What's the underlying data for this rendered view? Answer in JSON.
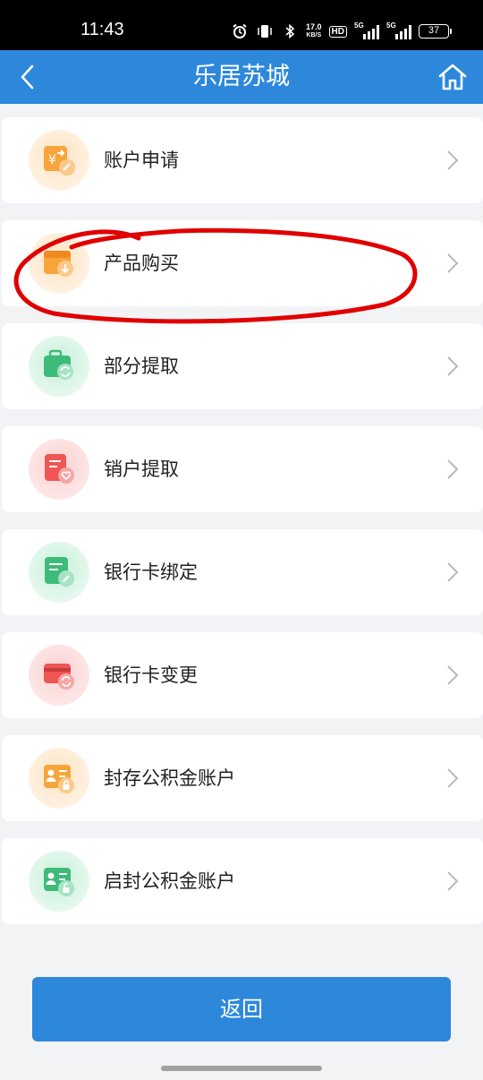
{
  "status_bar": {
    "time": "11:43",
    "net_speed_value": "17.0",
    "net_speed_unit": "KB/S",
    "hd_label": "HD",
    "signal1_label": "5G",
    "signal2_label": "5G",
    "battery": "37"
  },
  "header": {
    "title": "乐居苏城",
    "back_icon": "chevron-left-icon",
    "home_icon": "home-icon",
    "color": "#2d88db"
  },
  "menu": {
    "items": [
      {
        "label": "账户申请",
        "icon": "account-apply-icon",
        "color": "#f5a034"
      },
      {
        "label": "产品购买",
        "icon": "product-purchase-icon",
        "color": "#f5a034"
      },
      {
        "label": "部分提取",
        "icon": "partial-withdraw-icon",
        "color": "#3dbb78"
      },
      {
        "label": "销户提取",
        "icon": "close-account-withdraw-icon",
        "color": "#ef5555"
      },
      {
        "label": "银行卡绑定",
        "icon": "bank-card-bind-icon",
        "color": "#3dbb78"
      },
      {
        "label": "银行卡变更",
        "icon": "bank-card-change-icon",
        "color": "#ef5555"
      },
      {
        "label": "封存公积金账户",
        "icon": "seal-fund-account-icon",
        "color": "#f5a034"
      },
      {
        "label": "启封公积金账户",
        "icon": "unseal-fund-account-icon",
        "color": "#3dbb78"
      }
    ]
  },
  "footer": {
    "back_button_label": "返回"
  },
  "annotation_color": "#e00000"
}
